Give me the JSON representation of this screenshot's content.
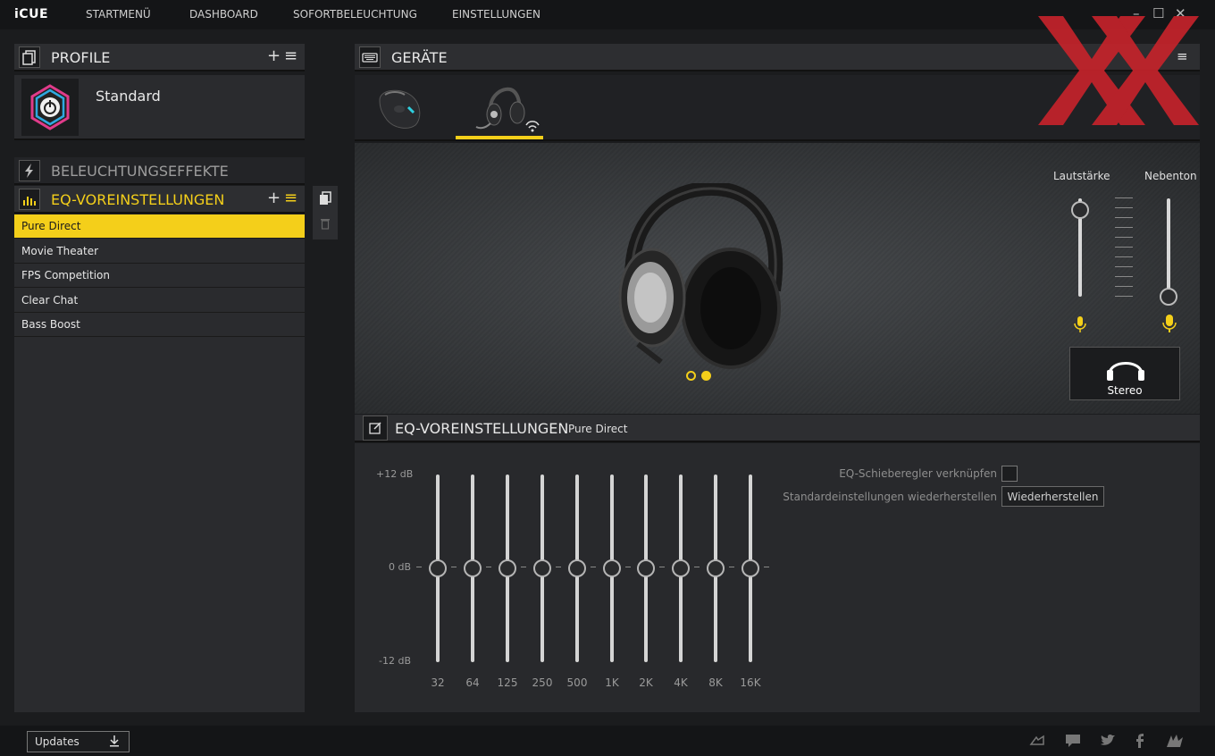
{
  "app": {
    "logo": "iCUE"
  },
  "nav": [
    "STARTMENÜ",
    "DASHBOARD",
    "SOFORTBELEUCHTUNG",
    "EINSTELLUNGEN"
  ],
  "window_controls": {
    "minimize": "–",
    "maximize": "☐",
    "close": "✕"
  },
  "profiles": {
    "title": "PROFILE",
    "add": "+",
    "menu": "≡",
    "current": "Standard"
  },
  "lighting": {
    "title": "BELEUCHTUNGSEFFEKTE"
  },
  "eq_presets": {
    "title": "EQ-VOREINSTELLUNGEN",
    "add": "+",
    "menu": "≡",
    "items": [
      "Pure Direct",
      "Movie Theater",
      "FPS Competition",
      "Clear Chat",
      "Bass Boost"
    ],
    "selected_index": 0
  },
  "devices": {
    "title": "GERÄTE",
    "menu": "≡",
    "items": [
      "mouse-device",
      "headset-device"
    ],
    "selected_index": 1
  },
  "audio": {
    "volume_label": "Lautstärke",
    "sidetone_label": "Nebenton",
    "volume_level": 0.9,
    "sidetone_level": 0.0,
    "mode_label": "Stereo"
  },
  "eq_panel": {
    "title": "EQ-VOREINSTELLUNGEN",
    "preset_name": "Pure Direct",
    "db_top": "+12 dB",
    "db_mid": "0 dB",
    "db_bottom": "-12 dB",
    "bands": [
      {
        "freq": "32",
        "gain_db": 0
      },
      {
        "freq": "64",
        "gain_db": 0
      },
      {
        "freq": "125",
        "gain_db": 0
      },
      {
        "freq": "250",
        "gain_db": 0
      },
      {
        "freq": "500",
        "gain_db": 0
      },
      {
        "freq": "1K",
        "gain_db": 0
      },
      {
        "freq": "2K",
        "gain_db": 0
      },
      {
        "freq": "4K",
        "gain_db": 0
      },
      {
        "freq": "8K",
        "gain_db": 0
      },
      {
        "freq": "16K",
        "gain_db": 0
      }
    ],
    "link_label": "EQ-Schieberegler verknüpfen",
    "restore_label": "Standardeinstellungen wiederherstellen",
    "restore_button": "Wiederherstellen"
  },
  "footer": {
    "updates": "Updates"
  },
  "colors": {
    "accent": "#f4cf1a",
    "watermark": "#c8232b"
  }
}
